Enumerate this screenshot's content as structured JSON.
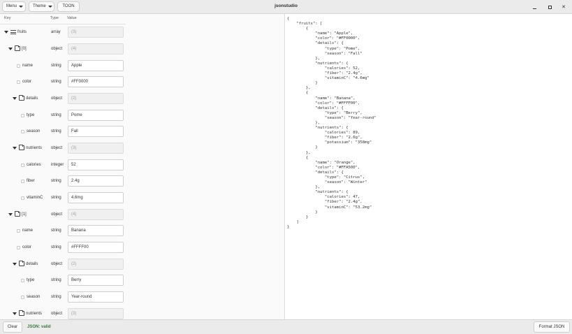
{
  "app": {
    "title": "jsonstudio"
  },
  "toolbar": {
    "menu_label": "Menu",
    "theme_label": "Theme",
    "toon_label": "TOON"
  },
  "window_controls": {
    "minimize": "minimize-icon",
    "maximize": "maximize-icon",
    "close": "close-icon"
  },
  "tree": {
    "columns": {
      "key": "Key",
      "type": "Type",
      "value": "Value"
    },
    "rows": [
      {
        "key": "fruits",
        "type": "array",
        "value": "(3)",
        "icon": "list-icon"
      },
      {
        "key": "[0]",
        "type": "object",
        "value": "(4)",
        "icon": "folder-icon"
      },
      {
        "key": "name",
        "type": "string",
        "value": "Apple",
        "icon": "leaf-icon"
      },
      {
        "key": "color",
        "type": "string",
        "value": "#FF0000",
        "icon": "leaf-icon"
      },
      {
        "key": "details",
        "type": "object",
        "value": "(2)",
        "icon": "folder-icon"
      },
      {
        "key": "type",
        "type": "string",
        "value": "Pome",
        "icon": "leaf-icon"
      },
      {
        "key": "season",
        "type": "string",
        "value": "Fall",
        "icon": "leaf-icon"
      },
      {
        "key": "nutrients",
        "type": "object",
        "value": "(3)",
        "icon": "folder-icon"
      },
      {
        "key": "calories",
        "type": "integer",
        "value": "52",
        "icon": "leaf-icon"
      },
      {
        "key": "fiber",
        "type": "string",
        "value": "2.4g",
        "icon": "leaf-icon"
      },
      {
        "key": "vitaminC",
        "type": "string",
        "value": "4.6mg",
        "icon": "leaf-icon"
      },
      {
        "key": "[1]",
        "type": "object",
        "value": "(4)",
        "icon": "folder-icon"
      },
      {
        "key": "name",
        "type": "string",
        "value": "Banana",
        "icon": "leaf-icon"
      },
      {
        "key": "color",
        "type": "string",
        "value": "#FFFF00",
        "icon": "leaf-icon"
      },
      {
        "key": "details",
        "type": "object",
        "value": "(2)",
        "icon": "folder-icon"
      },
      {
        "key": "type",
        "type": "string",
        "value": "Berry",
        "icon": "leaf-icon"
      },
      {
        "key": "season",
        "type": "string",
        "value": "Year-round",
        "icon": "leaf-icon"
      },
      {
        "key": "nutrients",
        "type": "object",
        "value": "(3)",
        "icon": "folder-icon"
      }
    ]
  },
  "editor": {
    "json_text": "{\n    \"fruits\": [\n        {\n            \"name\": \"Apple\",\n            \"color\": \"#FF0000\",\n            \"details\": {\n                \"type\": \"Pome\",\n                \"season\": \"Fall\"\n            },\n            \"nutrients\": {\n                \"calories\": 52,\n                \"fiber\": \"2.4g\",\n                \"vitaminC\": \"4.6mg\"\n            }\n        },\n        {\n            \"name\": \"Banana\",\n            \"color\": \"#FFFF00\",\n            \"details\": {\n                \"type\": \"Berry\",\n                \"season\": \"Year-round\"\n            },\n            \"nutrients\": {\n                \"calories\": 89,\n                \"fiber\": \"2.6g\",\n                \"potassium\": \"358mg\"\n            }\n        },\n        {\n            \"name\": \"Orange\",\n            \"color\": \"#FFA500\",\n            \"details\": {\n                \"type\": \"Citrus\",\n                \"season\": \"Winter\"\n            },\n            \"nutrients\": {\n                \"calories\": 47,\n                \"fiber\": \"2.4g\",\n                \"vitaminC\": \"53.2mg\"\n            }\n        }\n    ]\n}"
  },
  "footer": {
    "clear_label": "Clear",
    "status_text": "JSON: valid",
    "format_label": "Format JSON"
  },
  "colors": {
    "status_valid": "#2e7d32",
    "titlebar": "#ebebeb"
  }
}
